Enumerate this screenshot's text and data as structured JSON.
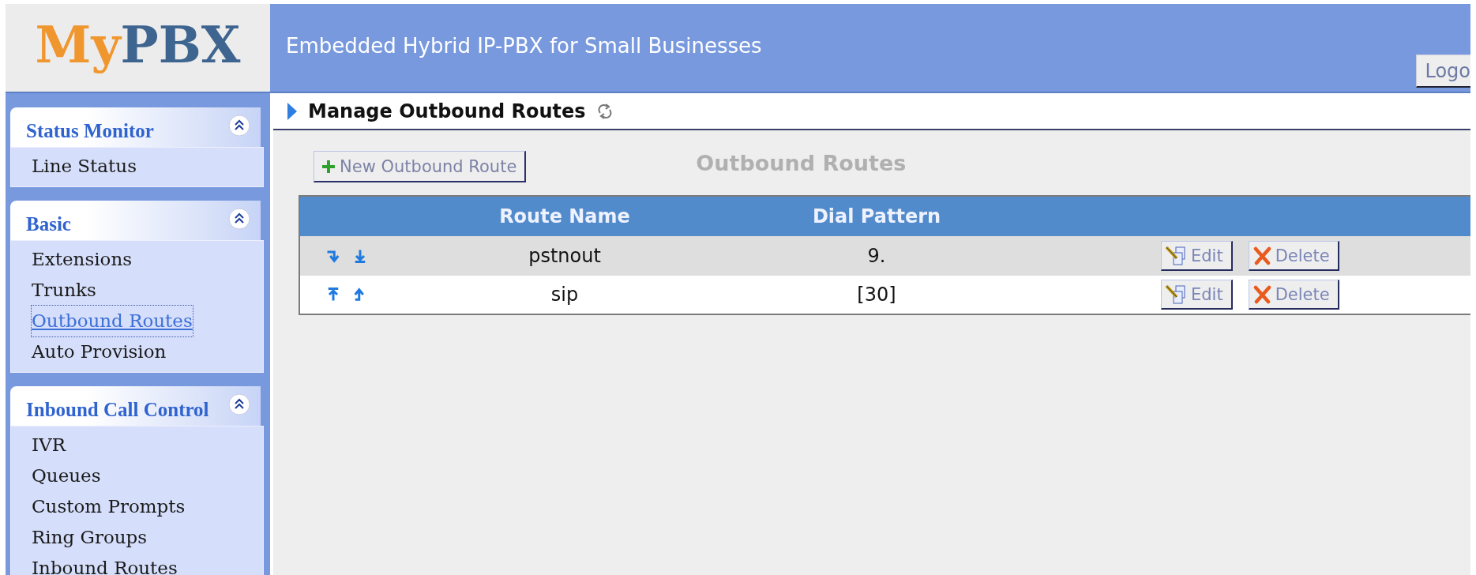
{
  "logo": {
    "first": "My",
    "second": "PBX"
  },
  "header": {
    "title": "Embedded Hybrid IP-PBX for Small Businesses",
    "logout": "Logo"
  },
  "sidebar": [
    {
      "title": "Status Monitor",
      "expanded": true,
      "items": [
        {
          "label": "Line Status",
          "selected": false
        }
      ]
    },
    {
      "title": "Basic",
      "expanded": true,
      "items": [
        {
          "label": "Extensions",
          "selected": false
        },
        {
          "label": "Trunks",
          "selected": false
        },
        {
          "label": "Outbound Routes",
          "selected": true
        },
        {
          "label": "Auto Provision",
          "selected": false
        }
      ]
    },
    {
      "title": "Inbound Call Control",
      "expanded": true,
      "items": [
        {
          "label": "IVR",
          "selected": false
        },
        {
          "label": "Queues",
          "selected": false
        },
        {
          "label": "Custom Prompts",
          "selected": false
        },
        {
          "label": "Ring Groups",
          "selected": false
        },
        {
          "label": "Inbound Routes",
          "selected": false
        }
      ]
    }
  ],
  "page": {
    "title": "Manage Outbound Routes",
    "new_button": "New Outbound Route",
    "heading": "Outbound Routes"
  },
  "table": {
    "columns": [
      "Route Name",
      "Dial Pattern"
    ],
    "rows": [
      {
        "move": [
          {
            "kind": "down"
          },
          {
            "kind": "bottom"
          }
        ],
        "route_name": "pstnout",
        "dial_pattern": "9.",
        "edit": "Edit",
        "delete": "Delete"
      },
      {
        "move": [
          {
            "kind": "top"
          },
          {
            "kind": "up"
          }
        ],
        "route_name": "sip",
        "dial_pattern": "[30]",
        "edit": "Edit",
        "delete": "Delete"
      }
    ]
  }
}
